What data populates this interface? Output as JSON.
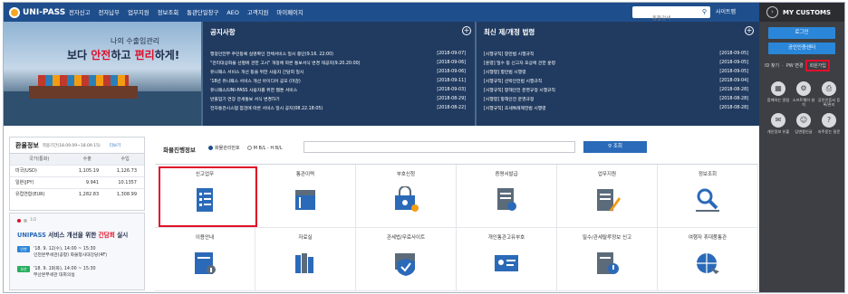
{
  "brand": {
    "logo_text": "UNI-PASS",
    "accent": "#1f4e8c",
    "highlight": "#e0102a"
  },
  "nav": {
    "menu": [
      "전자신고",
      "전자납부",
      "업무지원",
      "정보조회",
      "통관단일창구",
      "AEO",
      "고객지원",
      "마이페이지"
    ],
    "search_placeholder": "통합검색",
    "sitemap": "사이트맵"
  },
  "sidebar": {
    "title": "MY CUSTOMS",
    "login": "로그인",
    "cert_center": "공인인증센터",
    "links": [
      "ID 찾기",
      "PW 변경",
      "회원가입"
    ],
    "icons": [
      {
        "icon": "graph-icon",
        "label": "함께하는 알림"
      },
      {
        "icon": "gear-icon",
        "label": "소프트웨어 설치"
      },
      {
        "icon": "printer-icon",
        "label": "공인인증서 등록/관리"
      },
      {
        "icon": "chat-icon",
        "label": "개인정보 유출"
      },
      {
        "icon": "user-icon",
        "label": "답변중인글"
      },
      {
        "icon": "question-icon",
        "label": "자주묻는 질문"
      }
    ]
  },
  "hero": {
    "line1": "나의 수출입관리",
    "line2_pre": "보다 ",
    "line2_a": "안전",
    "line2_mid": "하고 ",
    "line2_b": "편리",
    "line2_post": "하게!"
  },
  "notices": {
    "title": "공지사항",
    "items": [
      {
        "title": "행정안전부 주민등록 실명확인 전체서비스 일시 중단(9.16. 22:00)",
        "date": "[2018-09-07]"
      },
      {
        "title": "\"관리대상화물 선별에 관한 고시\" 개정에 따른 통보서식 변경 재공지(9.20.20:00)",
        "date": "[2018-09-06]"
      },
      {
        "title": "유니패스 서비스 개선 등을 위한 사용자 간담회 일시",
        "date": "[2018-09-06]"
      },
      {
        "title": "'18년 유니패스 서비스 개선 아이디어 공모 (마감)",
        "date": "[2018-09-11]"
      },
      {
        "title": "유니패스/UNI-PASS 사용자를 위한 웹툰 서비스",
        "date": "[2018-09-03]"
      },
      {
        "title": "반출입기 연장 관세통보 서식 변경하기",
        "date": "[2018-08-29]"
      },
      {
        "title": "전자통관시스템 점검에 따른 서비스 일시 공지(08.22.18:05)",
        "date": "[2018-08-22]"
      }
    ]
  },
  "laws": {
    "title": "최신 제/개정 법령",
    "items": [
      {
        "title": "[시행규칙] 항만법 시행규칙",
        "date": "[2018-09-05]"
      },
      {
        "title": "[훈령] 밀수 등 신고자 포상에 관한 훈령",
        "date": "[2018-09-05]"
      },
      {
        "title": "[시행령] 항만법 시행령",
        "date": "[2018-09-05]"
      },
      {
        "title": "[시행규칙] 선박안전법 시행규칙",
        "date": "[2018-09-04]"
      },
      {
        "title": "[시행규칙] 항해안전 운영규정 시행규칙",
        "date": "[2018-08-28]"
      },
      {
        "title": "[시행령] 항해안전 운영규정",
        "date": "[2018-08-28]"
      },
      {
        "title": "[시행규칙] 조세특례제한법 시행령",
        "date": "[2018-08-28]"
      }
    ]
  },
  "rates": {
    "title": "환율정보",
    "subtitle": "적용기간(18.09.09~18.09.15)",
    "more": "더보기",
    "columns": [
      "국가(통화)",
      "수출",
      "수입"
    ],
    "rows": [
      [
        "미국(USD)",
        "1,105.19",
        "1,126.73"
      ],
      [
        "일본(JPY)",
        "9.941",
        "10.1357"
      ],
      [
        "유럽연합(EUR)",
        "1,282.83",
        "1,308.99"
      ]
    ]
  },
  "notice_box": {
    "page": "1/2",
    "title_a": "UNIPASS",
    "title_b": " 서비스 개선을 위한 ",
    "title_c": "간담회",
    "title_d": " 실시",
    "events": [
      {
        "tag": "인천",
        "line1": "'18. 9. 12(수), 14:00 ~ 15:30",
        "line2": "인천본부세관(공항) 화물청사대강당(4F)"
      },
      {
        "tag": "부산",
        "line1": "'18. 9. 19(화), 14:00 ~ 15:30",
        "line2": "부산본부세관 대회의실"
      }
    ]
  },
  "cargo": {
    "title": "화물진행정보",
    "options": [
      "화물관리번호",
      "M B/L - H B/L"
    ],
    "search_button": "조회"
  },
  "services": [
    {
      "label": "신고업무",
      "icon": "document-list-icon"
    },
    {
      "label": "통관이력",
      "icon": "books-icon"
    },
    {
      "label": "부호신청",
      "icon": "lock-card-icon"
    },
    {
      "label": "증명서발급",
      "icon": "certificate-icon"
    },
    {
      "label": "업무지원",
      "icon": "pen-document-icon"
    },
    {
      "label": "정보조회",
      "icon": "magnifier-icon"
    },
    {
      "label": "이용안내",
      "icon": "info-book-icon"
    },
    {
      "label": "자료실",
      "icon": "archive-icon"
    },
    {
      "label": "관세법/무료사이트",
      "icon": "shield-check-icon"
    },
    {
      "label": "개인통관고유부호",
      "icon": "id-card-icon"
    },
    {
      "label": "밀수/관세탈루정보 신고",
      "icon": "report-icon"
    },
    {
      "label": "여행자 휴대품통관",
      "icon": "globe-plane-icon"
    }
  ]
}
